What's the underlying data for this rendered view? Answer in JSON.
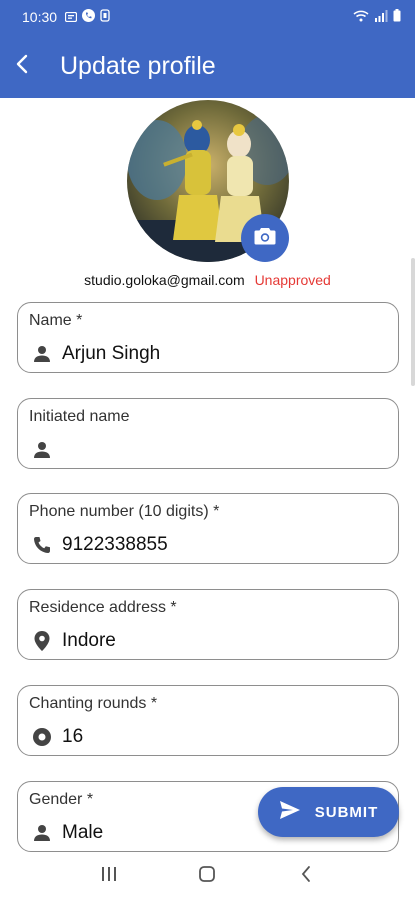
{
  "status_bar": {
    "time": "10:30",
    "left_icons": [
      "message-icon",
      "phone-icon",
      "notification-icon"
    ],
    "right_icons": [
      "wifi-icon",
      "signal-icon",
      "battery-icon"
    ]
  },
  "app_bar": {
    "title": "Update profile",
    "back_icon": "arrow-back-icon"
  },
  "profile": {
    "avatar": "profile-photo",
    "camera_icon": "camera-icon",
    "email": "studio.goloka@gmail.com",
    "status": "Unapproved"
  },
  "form": {
    "name": {
      "label": "Name *",
      "value": "Arjun Singh",
      "icon": "person-icon"
    },
    "initiated_name": {
      "label": "Initiated name",
      "value": "",
      "icon": "person-icon"
    },
    "phone": {
      "label": "Phone number (10 digits) *",
      "value": "9122338855",
      "icon": "phone-icon"
    },
    "address": {
      "label": "Residence address *",
      "value": "Indore",
      "icon": "location-icon"
    },
    "chanting": {
      "label": "Chanting rounds *",
      "value": "16",
      "icon": "chanting-icon"
    },
    "gender": {
      "label": "Gender *",
      "value": "Male",
      "icon": "person-icon"
    }
  },
  "submit": {
    "label": "SUBMIT",
    "icon": "send-icon"
  },
  "colors": {
    "primary": "#3f68c4",
    "status_red": "#e53935"
  }
}
